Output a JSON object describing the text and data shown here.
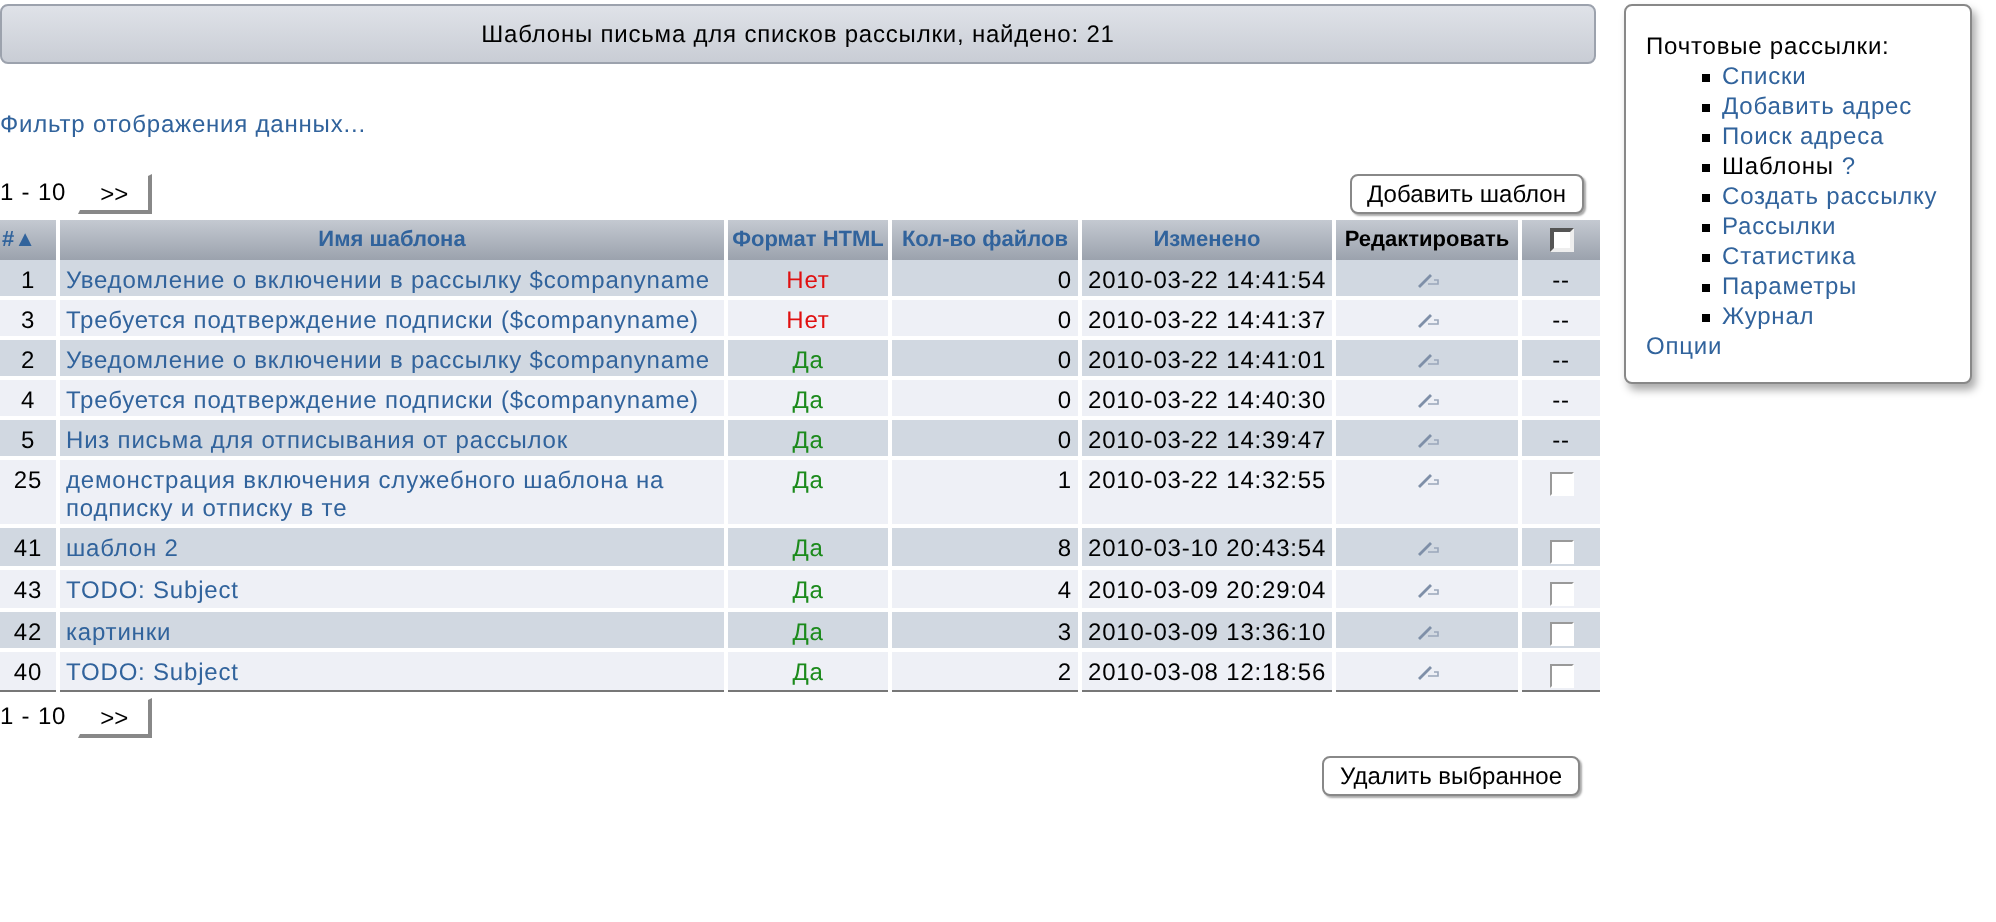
{
  "title": "Шаблоны письма для списков рассылки, найдено: 21",
  "filter_link": "Фильтр отображения данных...",
  "pager_top": {
    "range": "1 - 10",
    "next": ">>"
  },
  "add_button": "Добавить шаблон",
  "table": {
    "columns": [
      {
        "label": "#",
        "sort": "▲"
      },
      {
        "label": "Имя шаблона"
      },
      {
        "label": "Формат HTML"
      },
      {
        "label": "Кол-во файлов"
      },
      {
        "label": "Изменено"
      },
      {
        "label": "Редактировать"
      }
    ],
    "header_checkbox": {
      "checked": false
    },
    "rows": [
      {
        "id": "1",
        "name": "Уведомление о включении в рассылку $companyname",
        "html": false,
        "html_text": "Нет",
        "files": "0",
        "modified": "2010-03-22 14:41:54",
        "select": {
          "kind": "text",
          "text": "--"
        }
      },
      {
        "id": "3",
        "name": "Требуется подтверждение подписки ($companyname)",
        "html": false,
        "html_text": "Нет",
        "files": "0",
        "modified": "2010-03-22 14:41:37",
        "select": {
          "kind": "text",
          "text": "--"
        }
      },
      {
        "id": "2",
        "name": "Уведомление о включении в рассылку $companyname",
        "html": true,
        "html_text": "Да",
        "files": "0",
        "modified": "2010-03-22 14:41:01",
        "select": {
          "kind": "text",
          "text": "--"
        }
      },
      {
        "id": "4",
        "name": "Требуется подтверждение подписки ($companyname)",
        "html": true,
        "html_text": "Да",
        "files": "0",
        "modified": "2010-03-22 14:40:30",
        "select": {
          "kind": "text",
          "text": "--"
        }
      },
      {
        "id": "5",
        "name": "Низ письма для отписывания от рассылок",
        "html": true,
        "html_text": "Да",
        "files": "0",
        "modified": "2010-03-22 14:39:47",
        "select": {
          "kind": "text",
          "text": "--"
        }
      },
      {
        "id": "25",
        "name": "демонстрация включения служебного шаблона на подписку и отписку в те",
        "html": true,
        "html_text": "Да",
        "files": "1",
        "modified": "2010-03-22 14:32:55",
        "select": {
          "kind": "checkbox",
          "checked": false
        }
      },
      {
        "id": "41",
        "name": "шаблон 2",
        "html": true,
        "html_text": "Да",
        "files": "8",
        "modified": "2010-03-10 20:43:54",
        "select": {
          "kind": "checkbox",
          "checked": false
        }
      },
      {
        "id": "43",
        "name": "TODO: Subject",
        "html": true,
        "html_text": "Да",
        "files": "4",
        "modified": "2010-03-09 20:29:04",
        "select": {
          "kind": "checkbox",
          "checked": false
        }
      },
      {
        "id": "42",
        "name": "картинки",
        "html": true,
        "html_text": "Да",
        "files": "3",
        "modified": "2010-03-09 13:36:10",
        "select": {
          "kind": "checkbox",
          "checked": false
        }
      },
      {
        "id": "40",
        "name": "TODO: Subject",
        "html": true,
        "html_text": "Да",
        "files": "2",
        "modified": "2010-03-08 12:18:56",
        "select": {
          "kind": "checkbox",
          "checked": false
        }
      }
    ]
  },
  "pager_bottom": {
    "range": "1 - 10",
    "next": ">>"
  },
  "delete_button": "Удалить выбранное",
  "sidebar": {
    "heading": "Почтовые рассылки:",
    "items": [
      {
        "label": "Списки",
        "selected": false
      },
      {
        "label": "Добавить адрес",
        "selected": false
      },
      {
        "label": "Поиск адреса",
        "selected": false
      },
      {
        "label": "Шаблоны",
        "selected": true,
        "help": "?"
      },
      {
        "label": "Создать рассылку",
        "selected": false
      },
      {
        "label": "Рассылки",
        "selected": false
      },
      {
        "label": "Статистика",
        "selected": false
      },
      {
        "label": "Параметры",
        "selected": false
      },
      {
        "label": "Журнал",
        "selected": false
      }
    ],
    "options": "Опции"
  }
}
